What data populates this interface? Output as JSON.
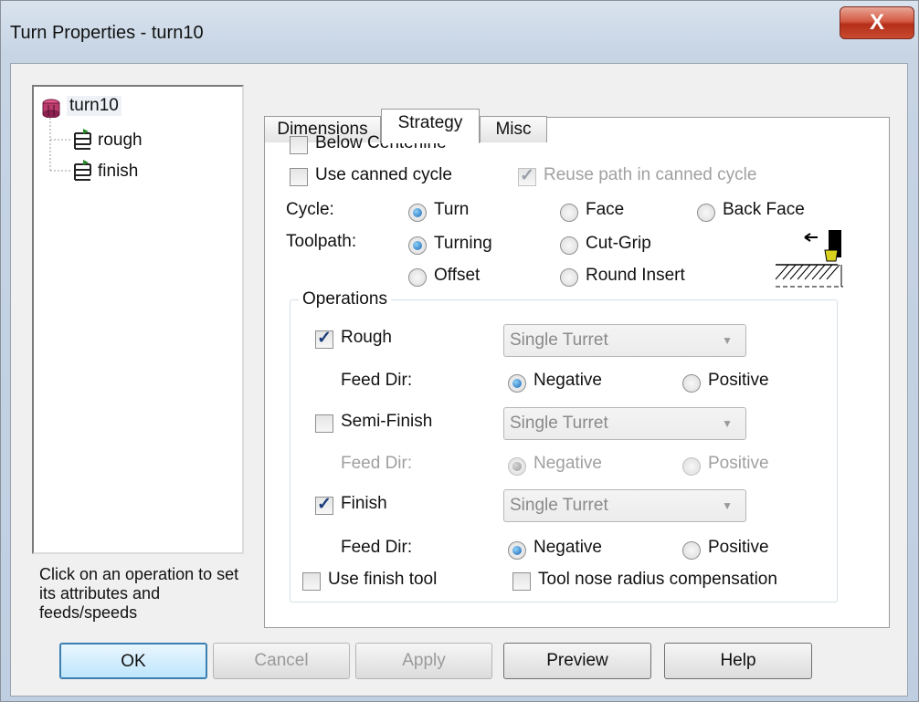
{
  "window": {
    "title": "Turn Properties - turn10",
    "close_label": "X"
  },
  "tree": {
    "root": "turn10",
    "children": [
      "rough",
      "finish"
    ]
  },
  "hint": "Click on an operation to set its attributes and feeds/speeds",
  "tabs": [
    "Dimensions",
    "Strategy",
    "Misc"
  ],
  "strategy": {
    "below_centerline": {
      "label": "Below Centerline",
      "checked": false
    },
    "use_canned_cycle": {
      "label": "Use canned cycle",
      "checked": false
    },
    "reuse_path": {
      "label": "Reuse path in canned cycle",
      "checked": true,
      "enabled": false
    },
    "cycle": {
      "label": "Cycle:",
      "options": [
        "Turn",
        "Face",
        "Back Face"
      ],
      "selected": "Turn"
    },
    "toolpath": {
      "label": "Toolpath:",
      "options": [
        "Turning",
        "Cut-Grip",
        "Offset",
        "Round Insert"
      ],
      "selected": "Turning"
    },
    "operations": {
      "label": "Operations",
      "rough": {
        "label": "Rough",
        "checked": true,
        "select": "Single Turret",
        "feed_label": "Feed Dir:",
        "neg": "Negative",
        "pos": "Positive",
        "selected": "Negative"
      },
      "semi": {
        "label": "Semi-Finish",
        "checked": false,
        "select": "Single Turret",
        "feed_label": "Feed Dir:",
        "neg": "Negative",
        "pos": "Positive",
        "selected": "Negative"
      },
      "finish": {
        "label": "Finish",
        "checked": true,
        "select": "Single Turret",
        "feed_label": "Feed Dir:",
        "neg": "Negative",
        "pos": "Positive",
        "selected": "Negative"
      }
    },
    "use_finish_tool": {
      "label": "Use finish tool",
      "checked": false
    },
    "tool_nose": {
      "label": "Tool nose radius compensation",
      "checked": false
    }
  },
  "buttons": {
    "ok": "OK",
    "cancel": "Cancel",
    "apply": "Apply",
    "preview": "Preview",
    "help": "Help"
  }
}
